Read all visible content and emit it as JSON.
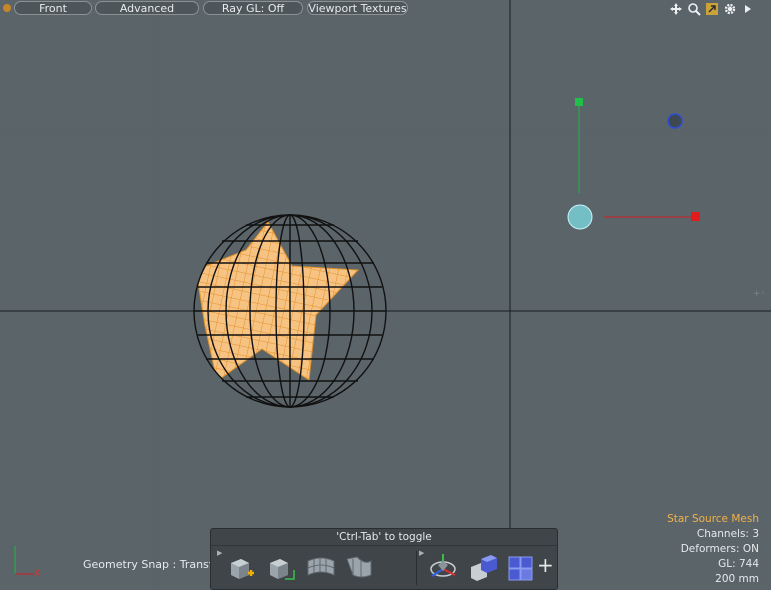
{
  "viewport": {
    "buttons": {
      "view": "Front",
      "mode": "Advanced",
      "raygl": "Ray GL: Off",
      "textures": "Viewport Textures"
    },
    "top_icons": [
      "move-view-icon",
      "zoom-view-icon",
      "maximize-icon",
      "gear-icon",
      "more-arrow-icon"
    ]
  },
  "status": {
    "geometry_snap": "Geometry Snap : Transform"
  },
  "info": {
    "item_name": "Star Source Mesh",
    "channels": "Channels: 3",
    "deformers": "Deformers: ON",
    "gl": "GL: 744",
    "scale": "200 mm"
  },
  "palette": {
    "toggle_hint": "'Ctrl-Tab' to toggle",
    "tools_left": [
      "add-item-icon",
      "item-select-icon",
      "curve-surface-icon",
      "deform-surface-icon"
    ],
    "tools_right": [
      "transform-gizmo-icon",
      "replicator-icon",
      "instance-cubes-icon"
    ],
    "add_label": "+"
  },
  "axis_labels": {
    "x": "X"
  },
  "colors": {
    "background": "#5b6469",
    "grid_major": "#4f585d",
    "mesh_orange": "#f0a84a",
    "title_accent": "#f0b34a",
    "locator_cyan": "#7fe6ee"
  }
}
